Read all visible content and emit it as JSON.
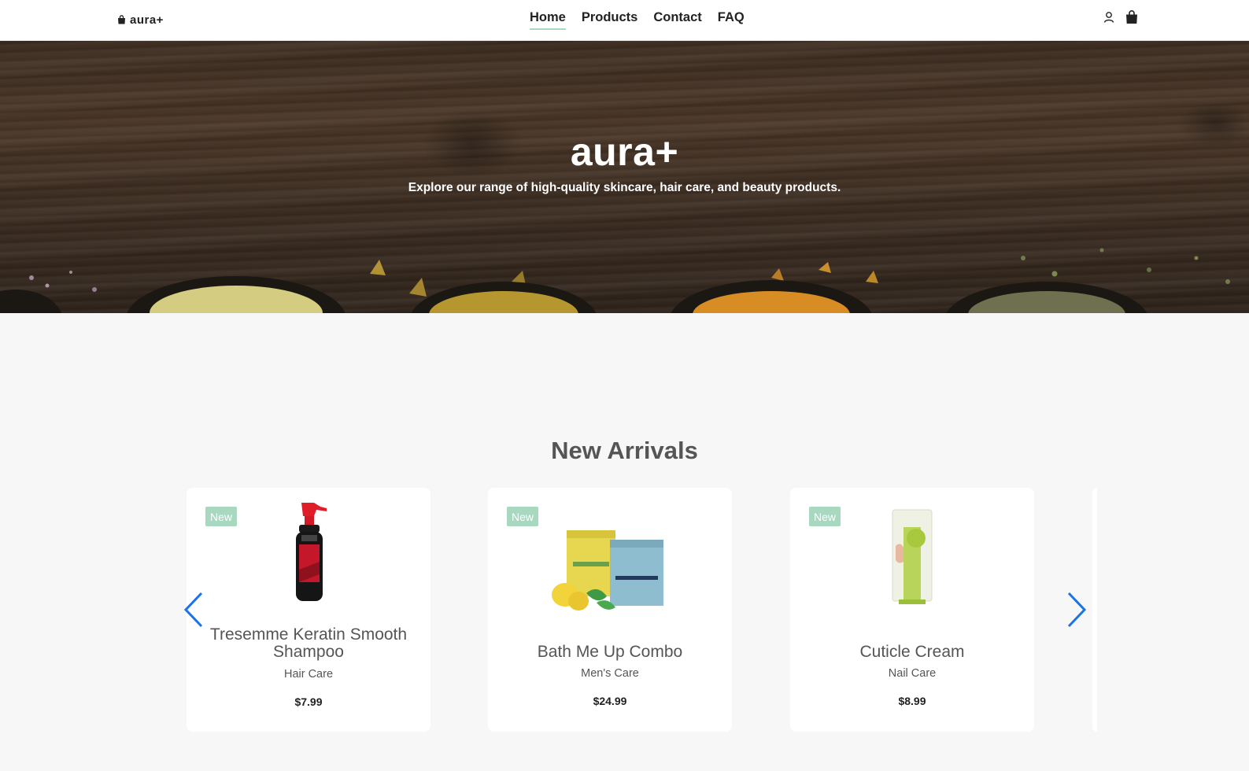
{
  "navbar": {
    "brand": "aura+",
    "links": [
      {
        "label": "Home",
        "active": true
      },
      {
        "label": "Products",
        "active": false
      },
      {
        "label": "Contact",
        "active": false
      },
      {
        "label": "FAQ",
        "active": false
      }
    ],
    "icons": [
      "user-icon",
      "shopping-bag-icon"
    ]
  },
  "hero": {
    "title": "aura+",
    "subtitle": "Explore our range of high-quality skincare, hair care, and beauty products."
  },
  "new_arrivals": {
    "title": "New Arrivals",
    "products": [
      {
        "badge": "New",
        "name": "Tresemme Keratin Smooth Shampoo",
        "category": "Hair Care",
        "price": "$7.99"
      },
      {
        "badge": "New",
        "name": "Bath Me Up Combo",
        "category": "Men's Care",
        "price": "$24.99"
      },
      {
        "badge": "New",
        "name": "Cuticle Cream",
        "category": "Nail Care",
        "price": "$8.99"
      }
    ],
    "prev_icon": "chevron-left-icon",
    "next_icon": "chevron-right-icon"
  },
  "colors": {
    "accent": "#a8d8c0",
    "arrow": "#1a73e8",
    "background": "#f7f7f7"
  }
}
